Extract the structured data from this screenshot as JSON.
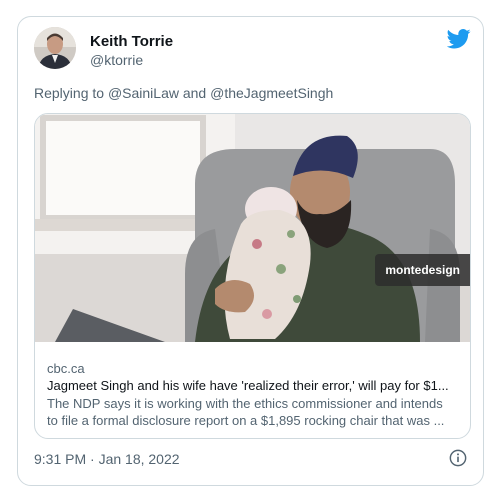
{
  "author": {
    "display_name": "Keith Torrie",
    "handle": "@ktorrie"
  },
  "reply": {
    "prefix": "Replying to ",
    "mention_1": "@SainiLaw",
    "joiner": " and ",
    "mention_2": "@theJagmeetSingh"
  },
  "card": {
    "watermark": "montedesign",
    "domain": "cbc.ca",
    "title": "Jagmeet Singh and his wife have 'realized their error,' will pay for $1...",
    "description_lines": [
      "The NDP says it is working with the ethics commissioner and intends",
      "to file a formal disclosure report on a $1,895 rocking chair that was ..."
    ]
  },
  "timestamp": "9:31 PM · Jan 18, 2022",
  "icons": {
    "brand": "twitter-bird-icon",
    "info": "info-icon"
  },
  "colors": {
    "twitter_blue": "#1d9bf0",
    "text_primary": "#0f1419",
    "text_secondary": "#536471",
    "border": "#cfd9de"
  }
}
